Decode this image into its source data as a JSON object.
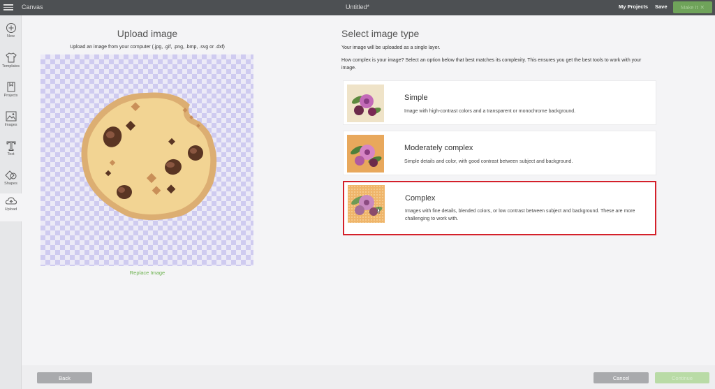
{
  "topbar": {
    "app_title": "Canvas",
    "document_title": "Untitled*",
    "my_projects": "My Projects",
    "save": "Save",
    "make_it": "Make It"
  },
  "sidebar": {
    "items": [
      {
        "label": "New",
        "icon": "plus-circle-icon"
      },
      {
        "label": "Templates",
        "icon": "tshirt-icon"
      },
      {
        "label": "Projects",
        "icon": "projects-icon"
      },
      {
        "label": "Images",
        "icon": "images-icon"
      },
      {
        "label": "Text",
        "icon": "text-icon"
      },
      {
        "label": "Shapes",
        "icon": "shapes-icon"
      },
      {
        "label": "Upload",
        "icon": "cloud-upload-icon"
      }
    ]
  },
  "upload": {
    "title": "Upload image",
    "subtitle": "Upload an image from your computer (.jpg, .gif, .png, .bmp, .svg or .dxf)",
    "replace_link": "Replace Image"
  },
  "image_type": {
    "title": "Select image type",
    "note": "Your image will be uploaded as a single layer.",
    "question": "How complex is your image? Select an option below that best matches its complexity. This ensures you get the best tools to work with your image.",
    "options": [
      {
        "name": "Simple",
        "description": "Image with high-contrast colors and a transparent or monochrome background.",
        "selected": false
      },
      {
        "name": "Moderately complex",
        "description": "Simple details and color, with good contrast between subject and background.",
        "selected": false
      },
      {
        "name": "Complex",
        "description": "Images with fine details, blended colors, or low contrast between subject and background. These are more challenging to work with.",
        "selected": true
      }
    ]
  },
  "footer": {
    "back": "Back",
    "cancel": "Cancel",
    "continue": "Continue"
  },
  "colors": {
    "topbar": "#4d5053",
    "accent_green": "#6fa35a",
    "selection_red": "#d4202a",
    "checker": "#cfcbf0"
  }
}
